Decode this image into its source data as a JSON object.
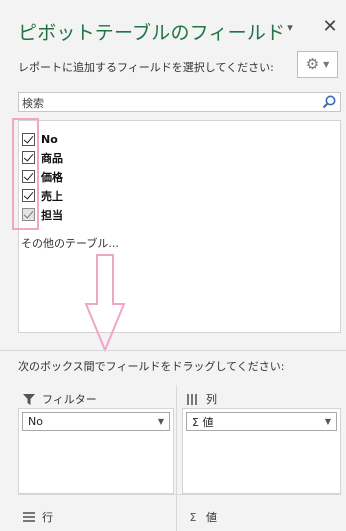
{
  "header": {
    "title": "ピボットテーブルのフィールド",
    "dropdown_glyph": "▾",
    "close_glyph": "✕"
  },
  "fields_section": {
    "instruction": "レポートに追加するフィールドを選択してください:",
    "search_placeholder": "検索",
    "fields": [
      {
        "label": "No",
        "checked": true
      },
      {
        "label": "商品",
        "checked": true
      },
      {
        "label": "価格",
        "checked": true
      },
      {
        "label": "売上",
        "checked": true
      },
      {
        "label": "担当",
        "checked": true
      }
    ],
    "more_tables_link": "その他のテーブル..."
  },
  "areas_section": {
    "instruction": "次のボックス間でフィールドをドラッグしてください:",
    "filters": {
      "label": "フィルター",
      "icon": "filter-icon",
      "items": [
        "No"
      ]
    },
    "columns": {
      "label": "列",
      "icon": "columns-icon",
      "items": [
        "Σ 値"
      ]
    },
    "rows": {
      "label": "行",
      "icon": "rows-icon",
      "items": []
    },
    "values": {
      "label": "値",
      "icon": "sigma-icon",
      "items": []
    }
  },
  "annotations": {
    "highlight_color": "#f0a6c6"
  },
  "colors": {
    "title_green": "#217346",
    "pane_background": "#f3f3f3"
  }
}
